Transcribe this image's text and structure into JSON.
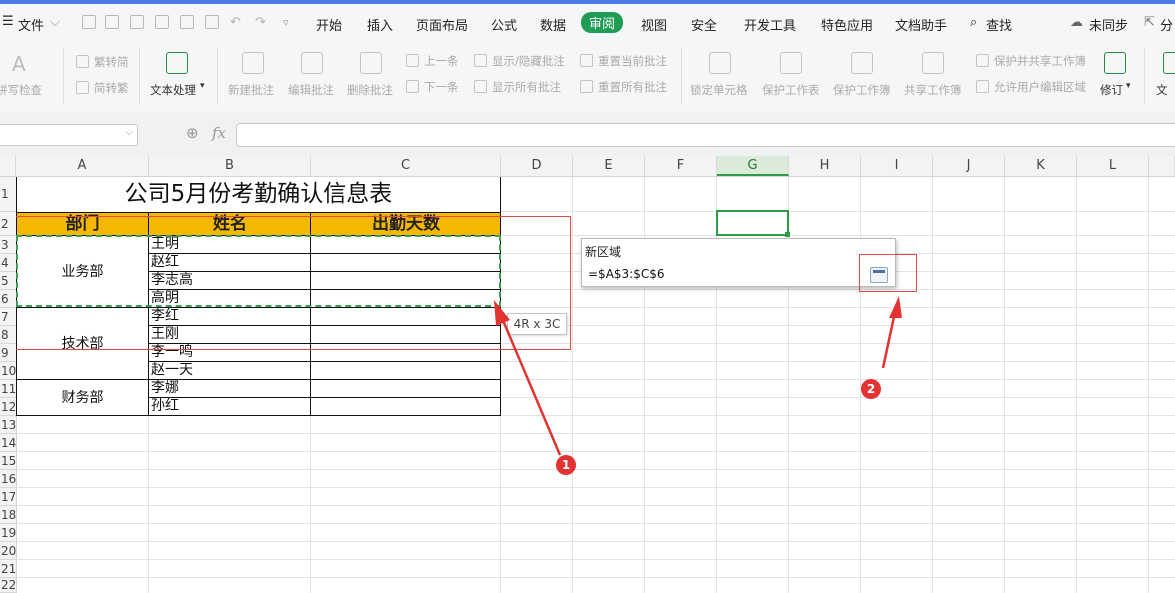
{
  "menubar": {
    "file_label": "文件",
    "tabs": [
      "开始",
      "插入",
      "页面布局",
      "公式",
      "数据",
      "审阅",
      "视图",
      "安全",
      "开发工具",
      "特色应用",
      "文档助手"
    ],
    "active_tab": "审阅",
    "search_label": "查找",
    "sync_label": "未同步",
    "share_label": "分"
  },
  "ribbon": {
    "spell_check": "拼写检查",
    "trad_to_simp": "繁转简",
    "simp_to_trad": "简转繁",
    "text_processing": "文本处理",
    "new_comment": "新建批注",
    "edit_comment": "编辑批注",
    "delete_comment": "删除批注",
    "prev_item": "上一条",
    "next_item": "下一条",
    "show_hide_comment": "显示/隐藏批注",
    "show_all_comments": "显示所有批注",
    "reset_current_comment": "重置当前批注",
    "reset_all_comments": "重置所有批注",
    "lock_cell": "锁定单元格",
    "protect_sheet": "保护工作表",
    "protect_workbook": "保护工作簿",
    "share_workbook": "共享工作簿",
    "protect_share_workbook": "保护并共享工作簿",
    "allow_edit_ranges": "允许用户编辑区域",
    "revise": "修订",
    "doc_label": "文"
  },
  "formula_bar": {
    "fx_label": "fx",
    "value": ""
  },
  "columns": [
    "A",
    "B",
    "C",
    "D",
    "E",
    "F",
    "G",
    "H",
    "I",
    "J",
    "K",
    "L"
  ],
  "selected_column": "G",
  "rows": [
    "1",
    "2",
    "3",
    "4",
    "5",
    "6",
    "7",
    "8",
    "9",
    "10",
    "11",
    "12",
    "13",
    "14",
    "15",
    "16",
    "17",
    "18",
    "19",
    "20",
    "21",
    "22"
  ],
  "sheet": {
    "title": "公司5月份考勤确认信息表",
    "headers": [
      "部门",
      "姓名",
      "出勤天数"
    ],
    "departments": [
      "业务部",
      "技术部",
      "财务部"
    ],
    "names": [
      "王明",
      "赵红",
      "李志高",
      "高明",
      "李红",
      "王刚",
      "李一鸣",
      "赵一天",
      "李娜",
      "孙红"
    ]
  },
  "dialog": {
    "title": "新区域",
    "value": "=$A$3:$C$6"
  },
  "range_tooltip": "4R x 3C",
  "annotations": {
    "badge1": "1",
    "badge2": "2"
  },
  "colors": {
    "accent_green": "#1f9d55",
    "header_fill": "#f5b800",
    "annotation_red": "#e23232"
  }
}
